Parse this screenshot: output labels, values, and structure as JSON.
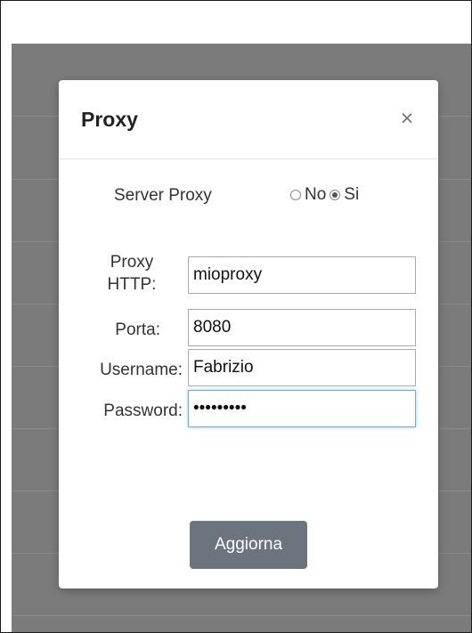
{
  "modal": {
    "title": "Proxy",
    "close_glyph": "×"
  },
  "proxy_server": {
    "label": "Server Proxy",
    "options": [
      {
        "label": "No",
        "checked": false
      },
      {
        "label": "Si",
        "checked": true
      }
    ]
  },
  "fields": {
    "http": {
      "label_line1": "Proxy",
      "label_line2": "HTTP:",
      "value": "mioproxy"
    },
    "port": {
      "label": "Porta:",
      "value": "8080"
    },
    "username": {
      "label": "Username:",
      "value": "Fabrizio"
    },
    "password": {
      "label": "Password:",
      "value": "fabrizio1"
    }
  },
  "actions": {
    "update_label": "Aggiorna"
  },
  "colors": {
    "backdrop": "#7b7b7b",
    "button": "#6c757d",
    "focus": "#66afe9"
  }
}
